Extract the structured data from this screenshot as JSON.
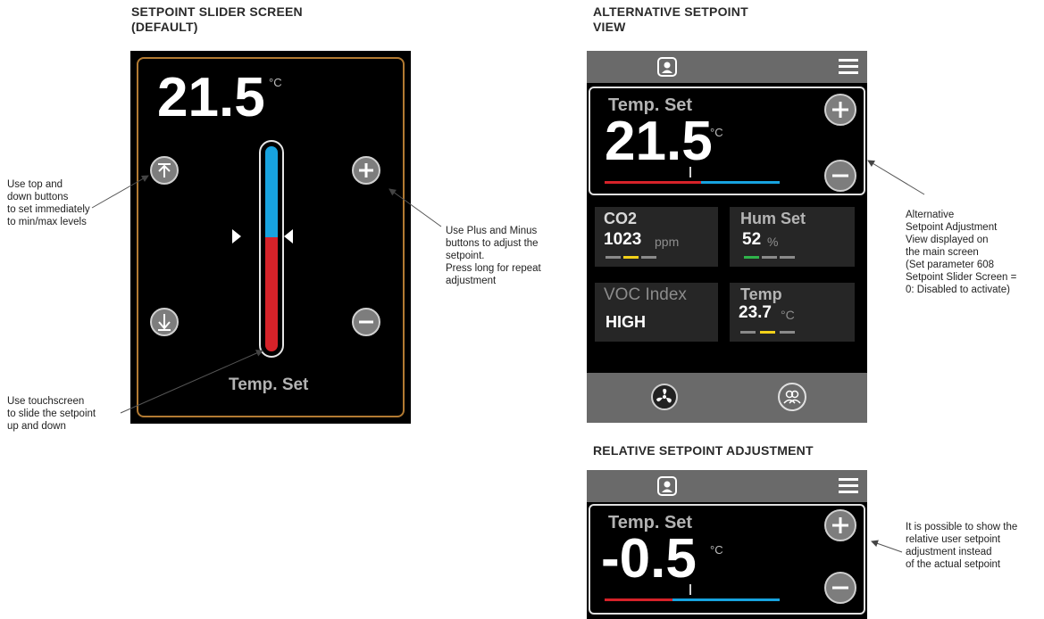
{
  "slider_section": {
    "title_line1": "SETPOINT SLIDER SCREEN",
    "title_line2": "(DEFAULT)",
    "value": "21.5",
    "unit": "°C",
    "label": "Temp. Set"
  },
  "alt_section": {
    "title_line1": "ALTERNATIVE SETPOINT",
    "title_line2": "VIEW",
    "card_label": "Temp. Set",
    "value": "21.5",
    "unit": "°C",
    "tiles": {
      "co2": {
        "title": "CO2",
        "value": "1023",
        "unit": "ppm"
      },
      "hum": {
        "title": "Hum Set",
        "value": "52",
        "unit": "%"
      },
      "voc": {
        "title": "VOC Index",
        "value": "HIGH"
      },
      "temp": {
        "title": "Temp",
        "value": "23.7",
        "unit": "°C"
      }
    }
  },
  "relative_section": {
    "title": "RELATIVE SETPOINT ADJUSTMENT",
    "card_label": "Temp. Set",
    "value": "-0.5",
    "unit": "°C"
  },
  "notes": {
    "top_down": "Use top and\ndown buttons\nto set immediately\nto min/max levels",
    "plus_minus": "Use Plus and Minus\nbuttons to adjust the\nsetpoint.\nPress long for repeat\nadjustment",
    "touchscreen": "Use touchscreen\nto slide the setpoint\nup and down",
    "alternative": "Alternative\nSetpoint Adjustment\nView displayed on\nthe main screen\n(Set parameter 608\nSetpoint Slider Screen =\n0: Disabled to activate)",
    "relative": "It is possible to show the\nrelative user setpoint\nadjustment instead\nof the actual setpoint"
  },
  "colors": {
    "blue": "#17a3df",
    "red": "#d62229",
    "frame": "#b27a32",
    "green": "#2fb34a",
    "yellow": "#f2d11a",
    "grey_seg": "#8a8a8a"
  },
  "icons": [
    "arrow-up-to-top-icon",
    "arrow-down-icon",
    "plus-icon",
    "minus-icon",
    "home-person-icon",
    "menu-icon",
    "fan-icon",
    "users-icon"
  ]
}
